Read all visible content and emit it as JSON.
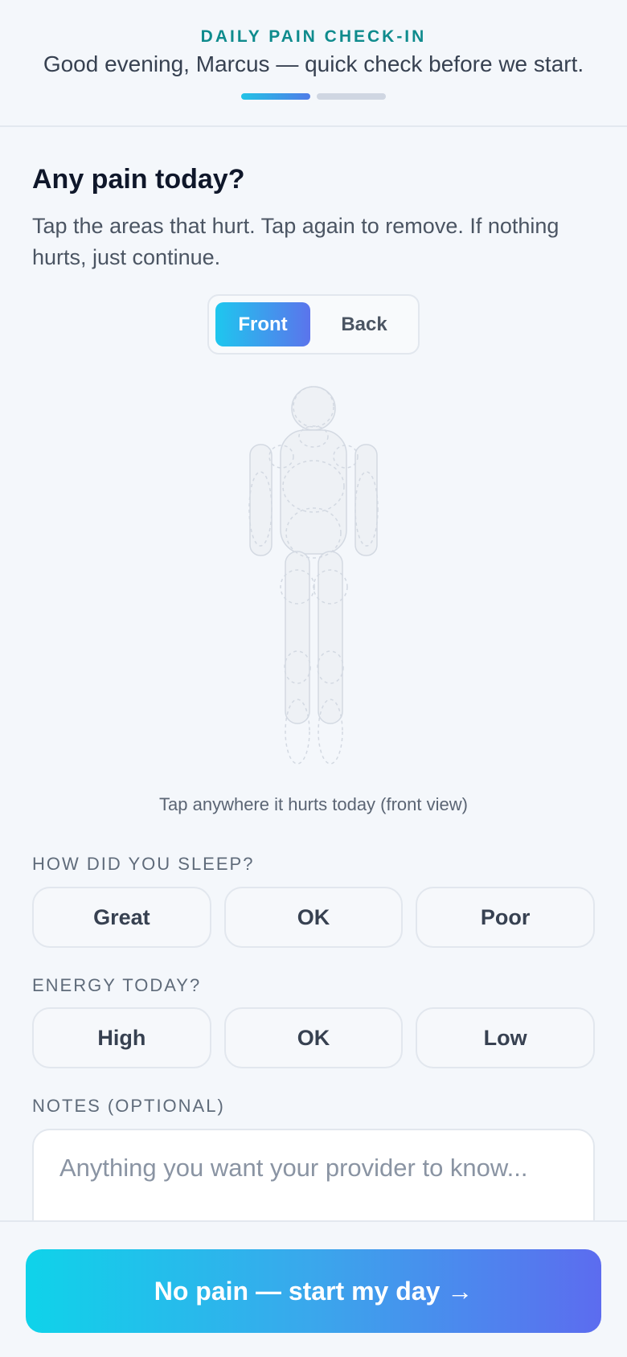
{
  "header": {
    "eyebrow": "DAILY PAIN CHECK-IN",
    "greeting": "Good evening, Marcus — quick check before we start.",
    "progress": {
      "current_step": 1,
      "total_steps": 2
    }
  },
  "pain": {
    "title": "Any pain today?",
    "subtitle": "Tap the areas that hurt. Tap again to remove. If nothing hurts, just continue.",
    "views": [
      {
        "label": "Front",
        "active": true
      },
      {
        "label": "Back",
        "active": false
      }
    ],
    "caption": "Tap anywhere it hurts today (front view)"
  },
  "sleep": {
    "label": "HOW DID YOU SLEEP?",
    "options": [
      "Great",
      "OK",
      "Poor"
    ]
  },
  "energy": {
    "label": "ENERGY TODAY?",
    "options": [
      "High",
      "OK",
      "Low"
    ]
  },
  "notes": {
    "label": "NOTES (OPTIONAL)",
    "placeholder": "Anything you want your provider to know..."
  },
  "cta": {
    "label": "No pain — start my day →"
  },
  "colors": {
    "accent_teal": "#0f8b8d",
    "gradient_start": "#0fd3ea",
    "gradient_end": "#5c6cef"
  }
}
